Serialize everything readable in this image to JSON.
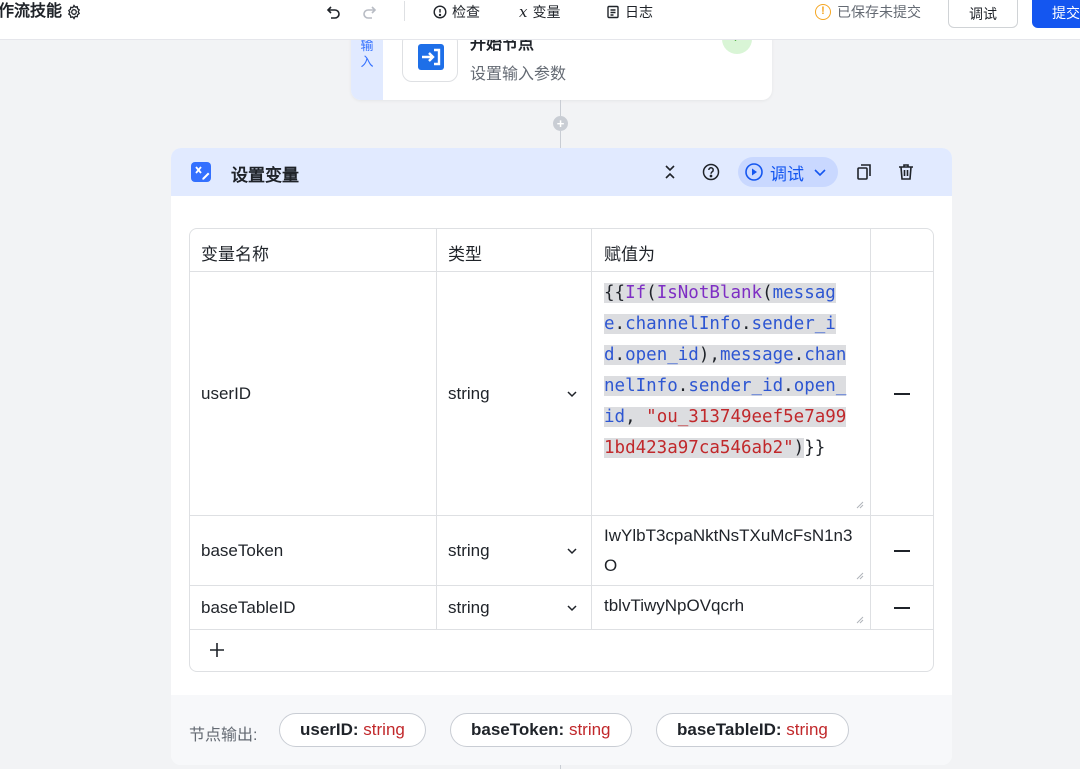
{
  "toolbar": {
    "app_title": "工作流技能",
    "check_label": "检查",
    "variable_label": "变量",
    "log_label": "日志",
    "save_status": "已保存未提交",
    "debug_button": "调试",
    "submit_button": "提交"
  },
  "start_node": {
    "tag": "输入",
    "title": "开始节点",
    "subtitle": "设置输入参数"
  },
  "var_node": {
    "title": "设置变量",
    "debug_label": "调试",
    "table": {
      "headers": [
        "变量名称",
        "类型",
        "赋值为"
      ],
      "rows": [
        {
          "name": "userID",
          "type": "string",
          "value_tokens": [
            {
              "t": "{{",
              "c": "pl",
              "hl": true
            },
            {
              "t": "If",
              "c": "fn",
              "hl": true
            },
            {
              "t": "(",
              "c": "pl",
              "hl": true
            },
            {
              "t": "IsNotBlank",
              "c": "fn",
              "hl": true
            },
            {
              "t": "(",
              "c": "pl",
              "hl": true
            },
            {
              "t": "message",
              "c": "pr",
              "hl": true
            },
            {
              "t": ".",
              "c": "pl",
              "hl": true
            },
            {
              "t": "channelInfo",
              "c": "pr",
              "hl": true
            },
            {
              "t": ".",
              "c": "pl",
              "hl": true
            },
            {
              "t": "sender_id",
              "c": "pr",
              "hl": true
            },
            {
              "t": ".",
              "c": "pl",
              "hl": true
            },
            {
              "t": "open_id",
              "c": "pr",
              "hl": true
            },
            {
              "t": "),",
              "c": "pl",
              "hl": true
            },
            {
              "t": "message",
              "c": "pr",
              "hl": true
            },
            {
              "t": ".",
              "c": "pl",
              "hl": true
            },
            {
              "t": "channelInfo",
              "c": "pr",
              "hl": true
            },
            {
              "t": ".",
              "c": "pl",
              "hl": true
            },
            {
              "t": "sender_id",
              "c": "pr",
              "hl": true
            },
            {
              "t": ".",
              "c": "pl",
              "hl": true
            },
            {
              "t": "open_id",
              "c": "pr",
              "hl": true
            },
            {
              "t": ", ",
              "c": "pl",
              "hl": true
            },
            {
              "t": "\"ou_313749eef5e7a991bd423a97ca546ab2\"",
              "c": "st",
              "hl": true
            },
            {
              "t": ")",
              "c": "pl",
              "hl": true
            },
            {
              "t": "}}",
              "c": "pl",
              "hl": false
            }
          ]
        },
        {
          "name": "baseToken",
          "type": "string",
          "value": "IwYlbT3cpaNktNsTXuMcFsN1n3O"
        },
        {
          "name": "baseTableID",
          "type": "string",
          "value": "tblvTiwyNpOVqcrh"
        }
      ]
    },
    "outputs": {
      "label": "节点输出:",
      "items": [
        {
          "name": "userID:",
          "type": " string"
        },
        {
          "name": "baseToken:",
          "type": " string"
        },
        {
          "name": "baseTableID:",
          "type": " string"
        }
      ]
    }
  },
  "colors": {
    "accent": "#1456f0",
    "header_bg": "#e1eaff",
    "string_type": "#c1282b",
    "function": "#7e2ec4",
    "property": "#2d56d2"
  }
}
